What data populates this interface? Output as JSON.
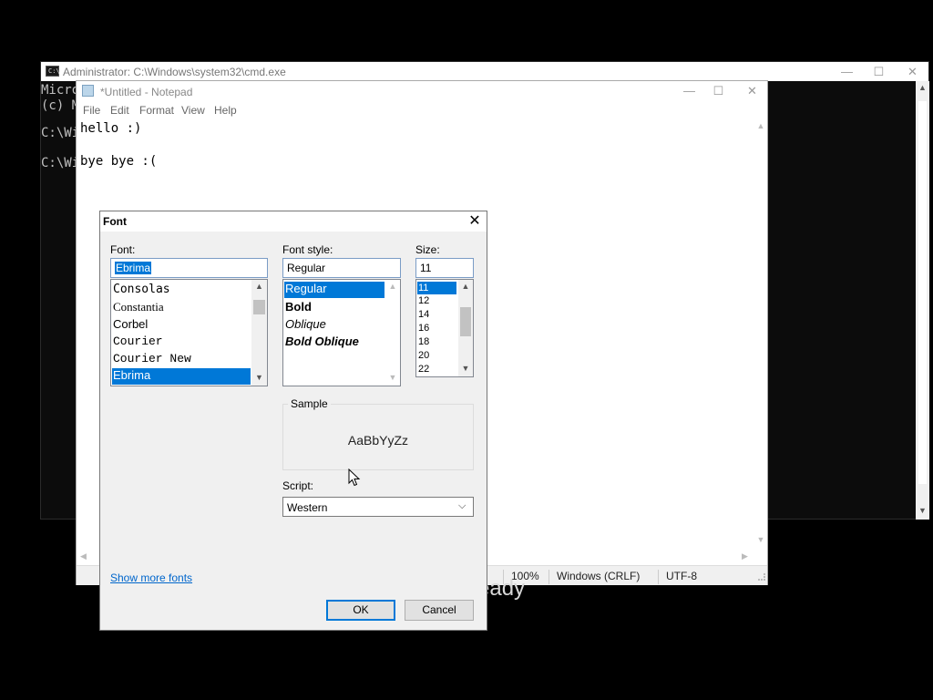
{
  "cmd": {
    "title": "Administrator: C:\\Windows\\system32\\cmd.exe",
    "icon": "cmd-icon",
    "lines": [
      "Micro",
      "(c) M",
      "",
      "C:\\Wi",
      "",
      "C:\\Wi"
    ]
  },
  "notepad": {
    "title": "*Untitled - Notepad",
    "menu": [
      "File",
      "Edit",
      "Format",
      "View",
      "Help"
    ],
    "text_lines": [
      "hello :)",
      "",
      "bye bye :("
    ],
    "status": {
      "zoom": "100%",
      "eol": "Windows (CRLF)",
      "encoding": "UTF-8"
    }
  },
  "background_text": "eady",
  "font_dialog": {
    "title": "Font",
    "font_label": "Font:",
    "font_value": "Ebrima",
    "fonts": [
      "Consolas",
      "Constantia",
      "Corbel",
      "Courier",
      "Courier New",
      "Ebrima"
    ],
    "style_label": "Font style:",
    "style_value": "Regular",
    "styles": [
      "Regular",
      "Bold",
      "Oblique",
      "Bold Oblique"
    ],
    "size_label": "Size:",
    "size_value": "11",
    "sizes": [
      "11",
      "12",
      "14",
      "16",
      "18",
      "20",
      "22"
    ],
    "sample_label": "Sample",
    "sample_text": "AaBbYyZz",
    "script_label": "Script:",
    "script_value": "Western",
    "show_more": "Show more fonts",
    "ok": "OK",
    "cancel": "Cancel"
  },
  "colors": {
    "selection": "#0078d7",
    "link": "#0066cc"
  }
}
